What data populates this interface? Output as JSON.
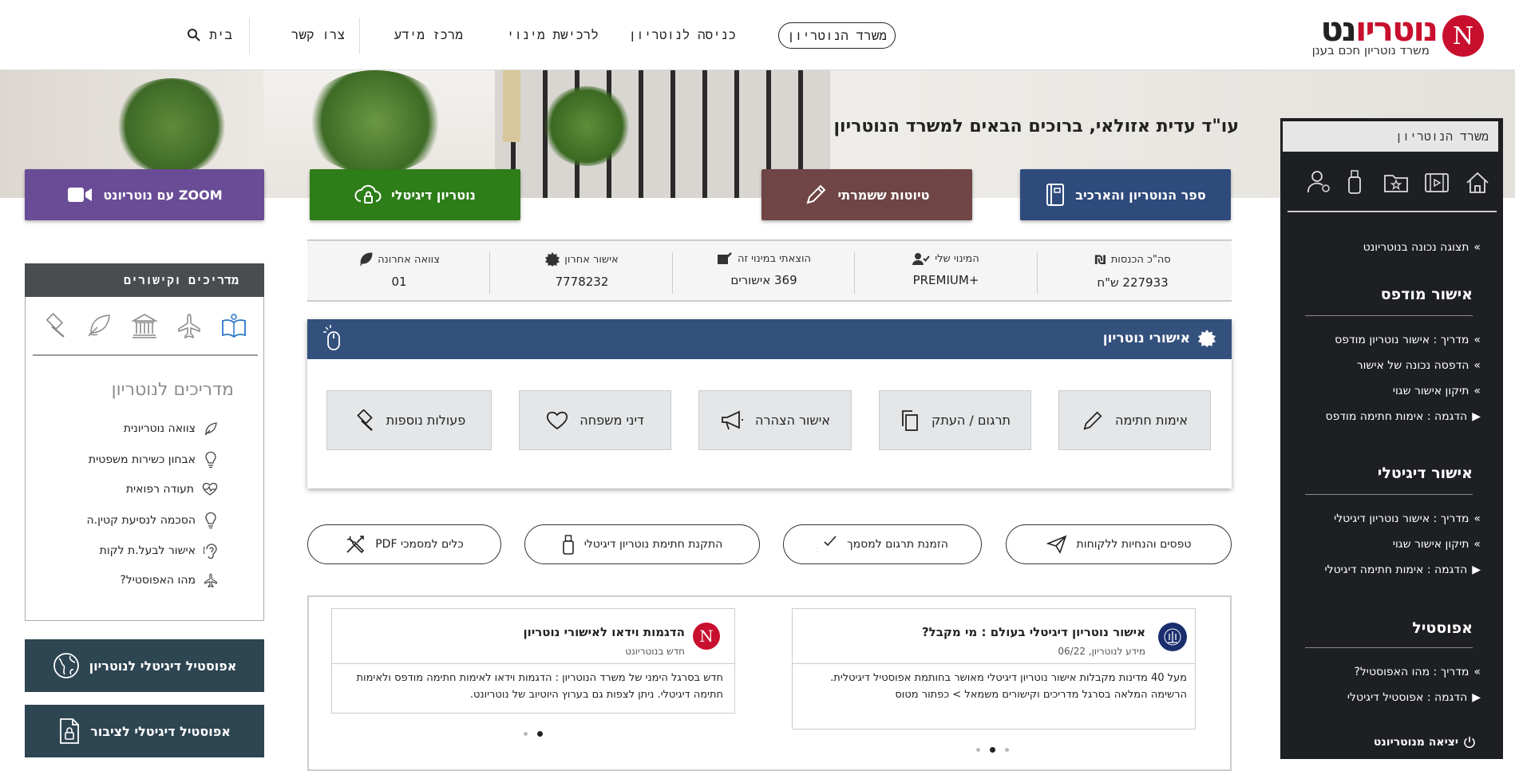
{
  "header": {
    "logo_red": "נוטריו",
    "logo_dark": "נט",
    "logo_letter": "N",
    "tagline": "משרד נוטריון חכם בענן",
    "nav": {
      "office": "משרד הנוטריון",
      "enter": "כניסה לנוטריון",
      "appoint": "לרכישת מינוי",
      "info": "מרכז מידע",
      "contact": "צרו קשר",
      "home": "בית"
    }
  },
  "hero": {
    "title": "עו\"ד עדית אזולאי, ברוכים הבאים למשרד הנוטריון"
  },
  "tiles": {
    "book": "ספר הנוטריון והארכיב",
    "drafts": "טיוטות ששמרתי",
    "digital": "נוטריון דיגיטלי",
    "zoom": "ZOOM עם נוטריונט"
  },
  "stats": {
    "income_label": "סה\"כ הכנסות",
    "income_value": "227933 ש\"ח",
    "plan_label": "המינוי שלי",
    "plan_value": "PREMIUM+",
    "used_label": "הוצאתי במינוי זה",
    "used_value": "369 אישורים",
    "last_label": "אישור אחרון",
    "last_value": "7778232",
    "will_label": "צוואה אחרונה",
    "will_value": "01"
  },
  "notary": {
    "title": "אישורי נוטריון",
    "actions": [
      "אימות חתימה",
      "תרגום / העתק",
      "אישור הצהרה",
      "דיני משפחה",
      "פעולות נוספות"
    ]
  },
  "pills": [
    "טפסים והנחיות ללקוחות",
    "הזמנת תרגום למסמך",
    "התקנת חתימת נוטריון דיגיטלי",
    "כלים למסמכי PDF"
  ],
  "news": [
    {
      "title": "אישור נוטריון דיגיטלי בעולם : מי מקבל?",
      "meta": "מידע לנוטריון, 06/22",
      "body": "מעל 40 מדינות מקבלות אישור נוטריון דיגיטלי מאושר בחותמת אפוסטיל דיגיטלית. הרשימה המלאה בסרגל מדריכים וקישורים משמאל > כפתור מטוס"
    },
    {
      "title": "הדגמות וידאו לאישורי נוטריון",
      "meta": "חדש בנוטריונט",
      "body": "חדש בסרגל הימני של משרד הנוטריון : הדגמות וידאו לאימות חתימה מודפס ולאימות חתימה דיגיטלי. ניתן לצפות גם בערוץ היוטיוב של נוטריונט.",
      "letter": "N"
    }
  ],
  "right_sidebar": {
    "tab": "משרד  הנוטריון",
    "display": "תצוגה נכונה בנוטריונט",
    "print_head": "אישור מודפס",
    "print_items": [
      "מדריך : אישור נוטריון מודפס",
      "הדפסה נכונה של אישור",
      "תיקון אישור שגוי",
      "הדגמה : אימות חתימה מודפס"
    ],
    "digital_head": "אישור דיגיטלי",
    "digital_items": [
      "מדריך : אישור נוטריון דיגיטלי",
      "תיקון אישור שגוי",
      "הדגמה : אימות חתימה דיגיטלי"
    ],
    "apostille_head": "אפוסטיל",
    "apostille_items": [
      "מדריך : מהו האפוסטיל?",
      "הדגמה : אפוסטיל דיגיטלי"
    ],
    "logout": "יציאה מנוטריונט"
  },
  "left_guides": {
    "tab": "מדריכים  וקישורים",
    "heading": "מדריכים לנוטריון",
    "items": [
      "צוואה נוטריונית",
      "אבחון כשירות משפטית",
      "תעודה רפואית",
      "הסכמה לנסיעת קטין.ה",
      "אישור לבעל.ת לקות",
      "מהו האפוסטיל?"
    ]
  },
  "left_buttons": {
    "apostille_notary": "אפוסטיל דיגיטלי לנוטריון",
    "apostille_public": "אפוסטיל דיגיטלי לציבור"
  },
  "colors": {
    "tile_blue": "#2f4b7c",
    "tile_brown": "#6f4545",
    "tile_green": "#2d7d18",
    "tile_purple": "#6a4c96",
    "panel_header": "#34507d"
  }
}
